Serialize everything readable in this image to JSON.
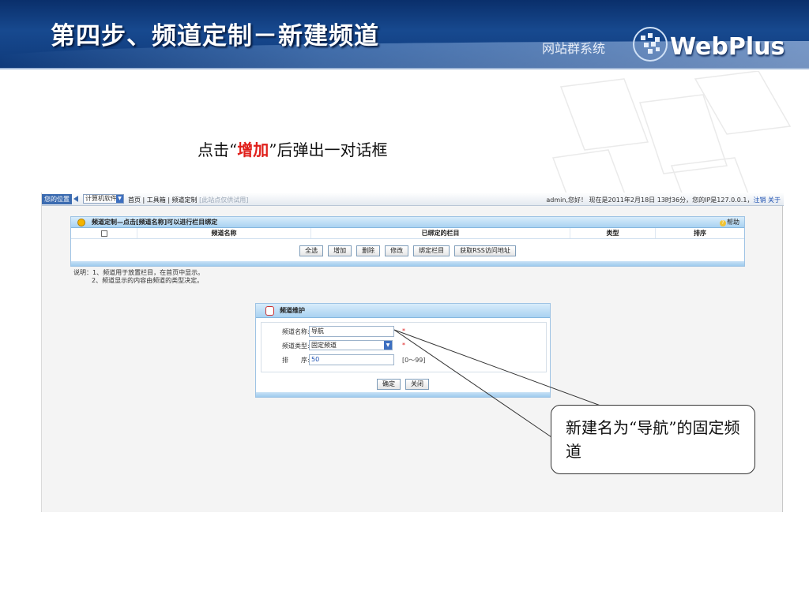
{
  "slide": {
    "title": "第四步、频道定制－新建频道",
    "brand_system": "网站群系统",
    "brand_logo": "WebPlus",
    "instruction": {
      "before": "点击“",
      "highlight": "增加",
      "after": "”后弹出一对话框"
    },
    "callout": "新建名为“导航”的固定频道",
    "colors": {
      "header_dark": "#0a2f6b",
      "highlight_red": "#e0201b",
      "panel_blue": "#a9d2f1"
    }
  },
  "app": {
    "topbar": {
      "location_label": "您的位置",
      "site_select": "计算机软件",
      "breadcrumb": "首页 | 工具箱 | 频道定制",
      "breadcrumb_muted": "[此站点仅供试用]",
      "session_text": "admin,您好！ 现在是2011年2月18日 13时36分，您的IP是127.0.0.1，",
      "logout": "注销",
      "about": "关于"
    },
    "panel": {
      "title": "频道定制—点击[频道名称]可以进行栏目绑定",
      "help": "帮助",
      "columns": [
        "频道名称",
        "已绑定的栏目",
        "类型",
        "排序"
      ],
      "buttons": [
        "全选",
        "增加",
        "删除",
        "修改",
        "绑定栏目",
        "获取RSS访问地址"
      ]
    },
    "notes": {
      "line1": "说明：1、频道用于放置栏目，在首页中显示。",
      "line2": "2、频道显示的内容由频道的类型决定。"
    },
    "dialog": {
      "title": "频道维护",
      "name_label": "频道名称:",
      "name_value": "导航",
      "type_label": "频道类型:",
      "type_value": "固定频道",
      "order_label": "排　　序:",
      "order_value": "50",
      "order_hint": "[0～99]",
      "required_mark": "*",
      "confirm": "确定",
      "close": "关闭"
    }
  }
}
